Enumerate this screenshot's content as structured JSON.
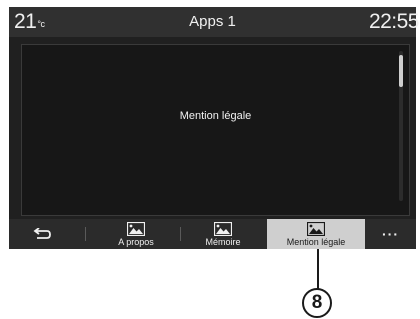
{
  "status_bar": {
    "temperature": "21",
    "temperature_unit": "°c",
    "title": "Apps 1",
    "time": "22:55"
  },
  "content": {
    "text": "Mention légale"
  },
  "bottom_bar": {
    "back_icon": "back-arrow-icon",
    "items": [
      {
        "label": "A propos",
        "icon": "image-icon",
        "selected": false
      },
      {
        "label": "Mémoire",
        "icon": "image-icon",
        "selected": false
      },
      {
        "label": "Mention légale",
        "icon": "image-icon",
        "selected": true
      }
    ],
    "more_label": "···"
  },
  "callout": {
    "number": "8"
  },
  "colors": {
    "screen_bg": "#202020",
    "topbar_bg": "#303030",
    "content_bg": "#171717",
    "selected_bg": "#cfcfcf"
  }
}
